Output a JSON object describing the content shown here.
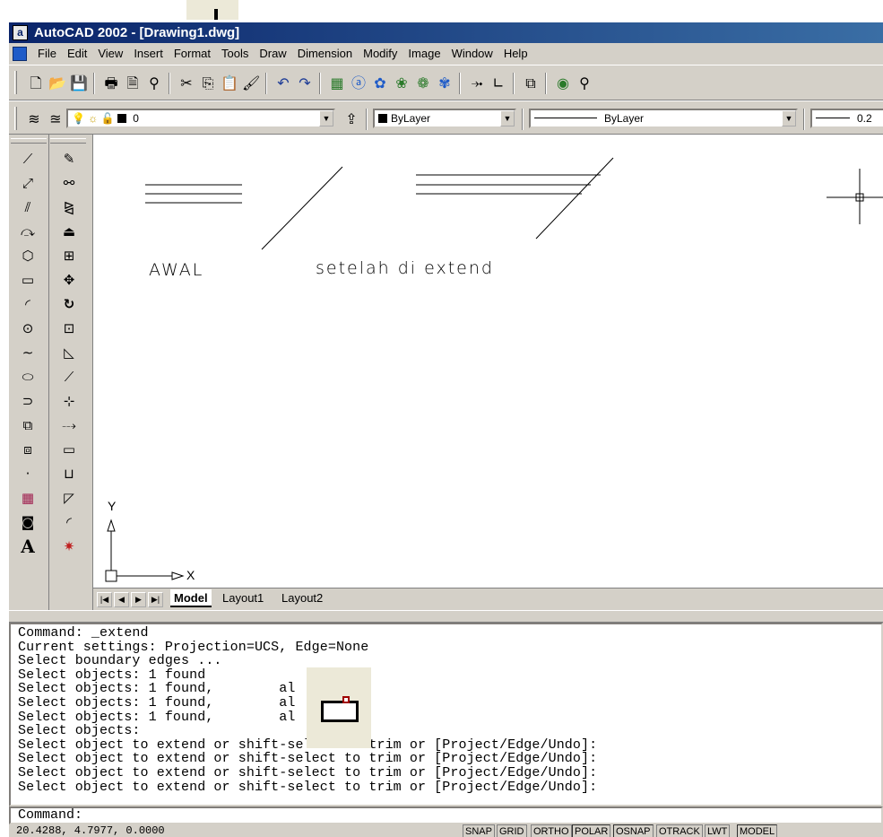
{
  "window": {
    "title": "AutoCAD 2002 - [Drawing1.dwg]"
  },
  "menu": [
    "File",
    "Edit",
    "View",
    "Insert",
    "Format",
    "Tools",
    "Draw",
    "Dimension",
    "Modify",
    "Image",
    "Window",
    "Help"
  ],
  "toolbar_properties": {
    "layer_value": "0",
    "color_value": "ByLayer",
    "linetype_value": "ByLayer",
    "lineweight_value": "0.2"
  },
  "drawing": {
    "label_before": "AWAL",
    "label_after": "setelah di extend",
    "ucs_x": "X",
    "ucs_y": "Y"
  },
  "layout_tabs": [
    "Model",
    "Layout1",
    "Layout2"
  ],
  "command_history": [
    "Command: _extend",
    "Current settings: Projection=UCS, Edge=None",
    "Select boundary edges ...",
    "Select objects: 1 found",
    "Select objects: 1 found,        al",
    "Select objects: 1 found,        al",
    "Select objects: 1 found,        al",
    "Select objects:",
    "Select object to extend or shift-select to trim or [Project/Edge/Undo]:",
    "Select object to extend or shift-select to trim or [Project/Edge/Undo]:",
    "Select object to extend or shift-select to trim or [Project/Edge/Undo]:",
    "Select object to extend or shift-select to trim or [Project/Edge/Undo]:"
  ],
  "command_prompt": "Command:",
  "status": {
    "coordinates": "20.4288,  4.7977, 0.0000",
    "modes": [
      "SNAP",
      "GRID",
      "ORTHO",
      "POLAR",
      "OSNAP",
      "OTRACK",
      "LWT",
      "MODEL"
    ]
  },
  "icons": {
    "toolbar1": [
      "new-icon",
      "open-icon",
      "save-icon",
      "print-icon",
      "print-preview-icon",
      "find-icon",
      "cut-icon",
      "copy-icon",
      "paste-icon",
      "match-properties-icon",
      "undo-icon",
      "redo-icon",
      "design-center-icon",
      "today-icon",
      "meet-now-icon",
      "publish-icon",
      "point-a-icon",
      "hyperlink-icon",
      "ucs-icon",
      "aerial-view-icon",
      "pan-icon"
    ],
    "draw_tools": [
      "line",
      "construction-line",
      "multiline",
      "polyline",
      "polygon",
      "rectangle",
      "arc",
      "circle",
      "spline",
      "ellipse",
      "revcloud",
      "insert-block",
      "make-block",
      "point",
      "hatch",
      "region",
      "multiline-text"
    ],
    "modify_tools": [
      "erase",
      "copy",
      "mirror",
      "offset",
      "array",
      "move",
      "rotate",
      "scale",
      "stretch",
      "lengthen",
      "trim",
      "extend",
      "break",
      "break-at-point",
      "chamfer",
      "fillet",
      "explode"
    ]
  }
}
